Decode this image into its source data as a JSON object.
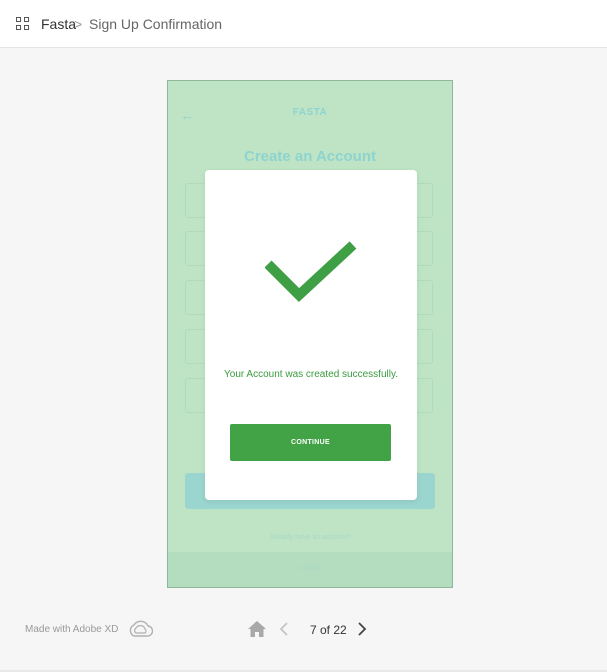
{
  "header": {
    "project_name": "Fasta",
    "separator": ">",
    "screen_name": "Sign Up Confirmation"
  },
  "artboard": {
    "back_glyph": "←",
    "brand": "FASTA",
    "heading": "Create an Account",
    "already_text": "Already have an account?",
    "login_text": "LOGIN",
    "colors": {
      "background": "#bee4c5",
      "accent_faded": "#8fd3cf"
    }
  },
  "modal": {
    "message": "Your Account was created successfully.",
    "continue_label": "CONTINUE",
    "colors": {
      "primary": "#41a345",
      "check": "#3f9f44"
    }
  },
  "footer": {
    "made_with": "Made with Adobe XD",
    "page_counter": "7 of 22",
    "icons": [
      "creative-cloud-icon",
      "home-icon",
      "chevron-left-icon",
      "chevron-right-icon"
    ]
  }
}
